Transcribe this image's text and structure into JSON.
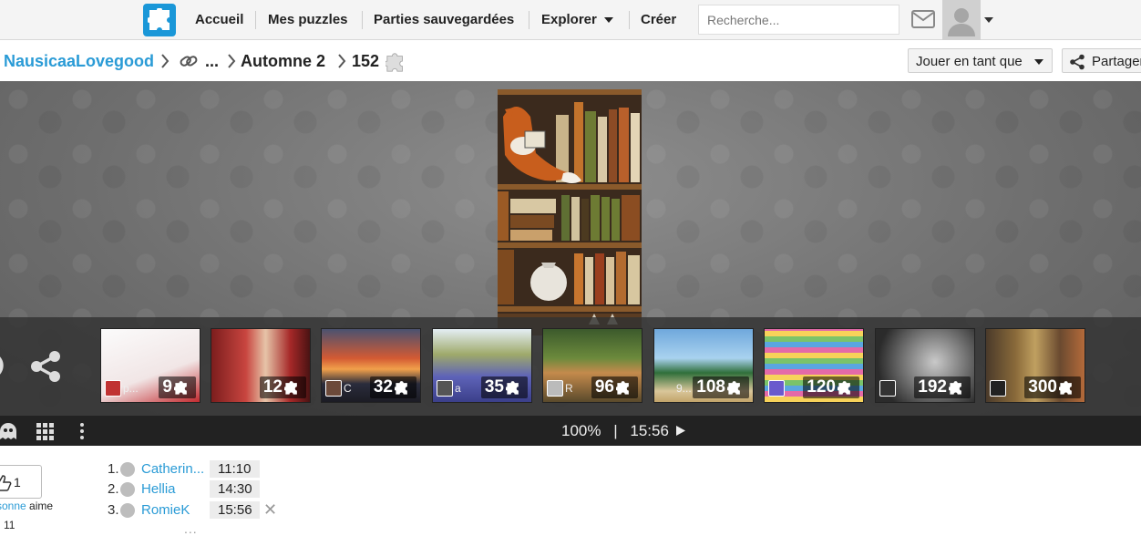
{
  "nav": {
    "home": "Accueil",
    "my_puzzles": "Mes puzzles",
    "saved_games": "Parties sauvegardées",
    "explore": "Explorer",
    "create": "Créer",
    "search_placeholder": "Recherche..."
  },
  "breadcrumb": {
    "user": "NausicaaLovegood",
    "ellipsis": "...",
    "album": "Automne 2",
    "pieces": "152"
  },
  "actions": {
    "play_as": "Jouer en tant que",
    "share": "Partager"
  },
  "thumbnails": [
    {
      "count": "9",
      "user_label": "p..."
    },
    {
      "count": "12",
      "user_label": ""
    },
    {
      "count": "32",
      "user_label": "C"
    },
    {
      "count": "35",
      "user_label": "a"
    },
    {
      "count": "96",
      "user_label": "R"
    },
    {
      "count": "108",
      "user_label": "9..."
    },
    {
      "count": "120",
      "user_label": ""
    },
    {
      "count": "192",
      "user_label": ""
    },
    {
      "count": "300",
      "user_label": ""
    }
  ],
  "toolbar": {
    "progress": "100%",
    "divider": "|",
    "time": "15:56"
  },
  "likes": {
    "count": "1",
    "who": "sonne",
    "text": " aime",
    "views": "11"
  },
  "scores": [
    {
      "rank": "1.",
      "name": "Catherin...",
      "time": "11:10"
    },
    {
      "rank": "2.",
      "name": "Hellia",
      "time": "14:30"
    },
    {
      "rank": "3.",
      "name": "RomieK",
      "time": "15:56"
    }
  ],
  "more": "...",
  "colors": {
    "accent": "#2a9bd6",
    "logo": "#1a97d8"
  }
}
